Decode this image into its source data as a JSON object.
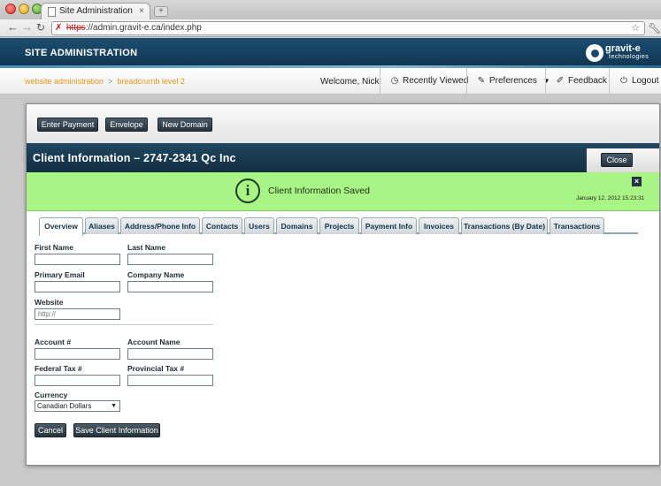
{
  "browser": {
    "tab_title": "Site Administration",
    "new_tab": "+",
    "url_https": "https",
    "url_rest": "://admin.gravit-e.ca/index.php"
  },
  "header": {
    "site_title": "SITE ADMINISTRATION",
    "logo_name": "gravit-e",
    "logo_tagline": "technologies"
  },
  "nav": {
    "breadcrumb_root": "website administration",
    "breadcrumb_sep": ">",
    "breadcrumb_level2": "breadcrumb level 2",
    "welcome": "Welcome, Nick",
    "recently_viewed": "Recently Viewed",
    "preferences": "Preferences",
    "feedback": "Feedback",
    "logout": "Logout"
  },
  "actions": {
    "enter_payment": "Enter Payment",
    "envelope": "Envelope",
    "new_domain": "New Domain"
  },
  "client": {
    "title": "Client Information – 2747-2341 Qc Inc",
    "close_label": "Close"
  },
  "alert": {
    "message": "Client Information Saved",
    "timestamp": "January 12, 2012 15:23:31",
    "close": "×"
  },
  "tabs": [
    {
      "label": "Overview",
      "active": true
    },
    {
      "label": "Aliases"
    },
    {
      "label": "Address/Phone Info"
    },
    {
      "label": "Contacts"
    },
    {
      "label": "Users"
    },
    {
      "label": "Domains"
    },
    {
      "label": "Projects"
    },
    {
      "label": "Payment Info"
    },
    {
      "label": "Invoices"
    },
    {
      "label": "Transactions (By Date)"
    },
    {
      "label": "Transactions"
    }
  ],
  "form": {
    "first_name_label": "First Name",
    "first_name_value": "",
    "last_name_label": "Last Name",
    "last_name_value": "",
    "primary_email_label": "Primary Email",
    "primary_email_value": "",
    "company_name_label": "Company Name",
    "company_name_value": "",
    "website_label": "Website",
    "website_placeholder": "http://",
    "account_num_label": "Account #",
    "account_num_value": "",
    "account_name_label": "Account Name",
    "account_name_value": "",
    "federal_tax_label": "Federal Tax #",
    "federal_tax_value": "",
    "provincial_tax_label": "Provincial Tax #",
    "provincial_tax_value": "",
    "currency_label": "Currency",
    "currency_selected": "Canadian Dollars",
    "cancel_label": "Cancel",
    "save_label": "Save Client Information"
  }
}
